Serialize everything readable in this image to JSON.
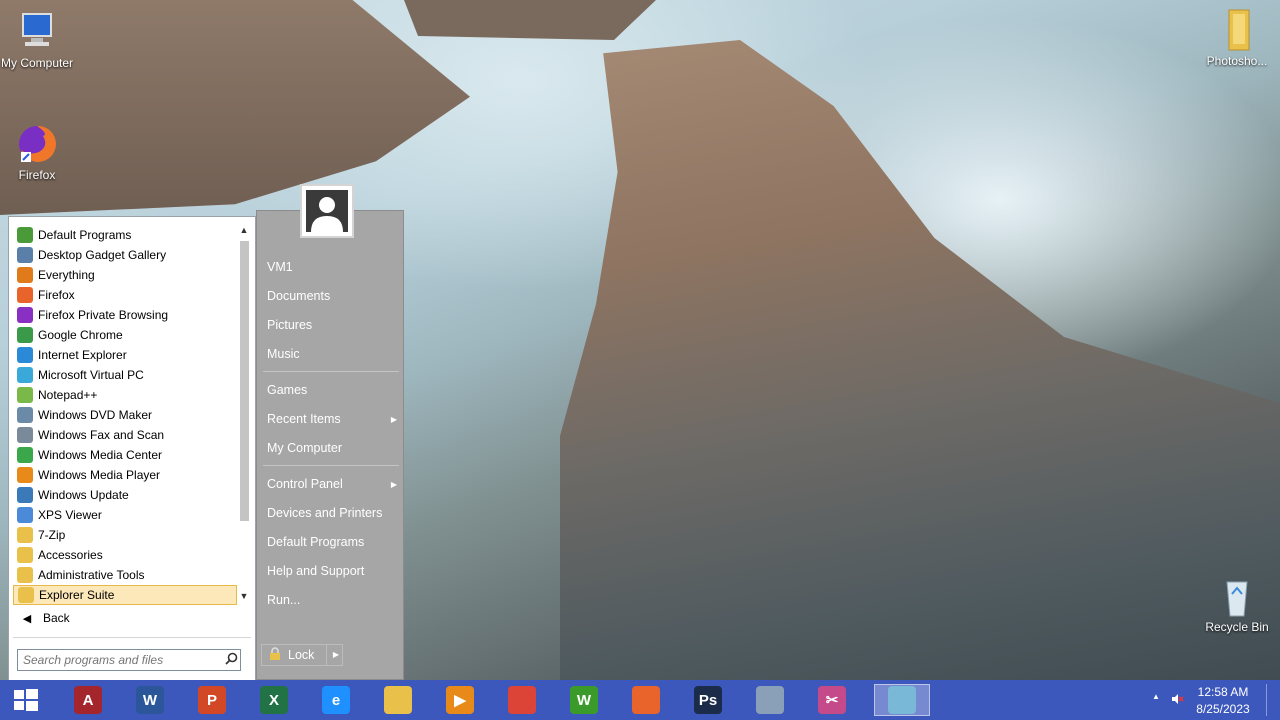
{
  "desktop": {
    "icons": [
      {
        "label": "My Computer"
      },
      {
        "label": "Firefox"
      },
      {
        "label": "Photosho..."
      },
      {
        "label": "Recycle Bin"
      }
    ]
  },
  "start_menu": {
    "programs": [
      {
        "label": "Default Programs",
        "icon": "default-programs-icon",
        "color": "#4a9a3a"
      },
      {
        "label": "Desktop Gadget Gallery",
        "icon": "gadget-gallery-icon",
        "color": "#5a7fa8"
      },
      {
        "label": "Everything",
        "icon": "everything-search-icon",
        "color": "#e07a1a"
      },
      {
        "label": "Firefox",
        "icon": "firefox-icon",
        "color": "#e8642a"
      },
      {
        "label": "Firefox Private Browsing",
        "icon": "firefox-private-icon",
        "color": "#8a2fc4"
      },
      {
        "label": "Google Chrome",
        "icon": "chrome-icon",
        "color": "#3a9a4a"
      },
      {
        "label": "Internet Explorer",
        "icon": "internet-explorer-icon",
        "color": "#2a8ad8"
      },
      {
        "label": "Microsoft Virtual PC",
        "icon": "virtual-pc-icon",
        "color": "#3aa8d8"
      },
      {
        "label": "Notepad++",
        "icon": "notepad-plus-icon",
        "color": "#7ab84a"
      },
      {
        "label": "Windows DVD Maker",
        "icon": "dvd-maker-icon",
        "color": "#6a8aa8"
      },
      {
        "label": "Windows Fax and Scan",
        "icon": "fax-scan-icon",
        "color": "#7a8a9a"
      },
      {
        "label": "Windows Media Center",
        "icon": "media-center-icon",
        "color": "#3aa84a"
      },
      {
        "label": "Windows Media Player",
        "icon": "media-player-icon",
        "color": "#e88a1a"
      },
      {
        "label": "Windows Update",
        "icon": "windows-update-icon",
        "color": "#3a7ab8"
      },
      {
        "label": "XPS Viewer",
        "icon": "xps-viewer-icon",
        "color": "#4a8ad8"
      },
      {
        "label": "7-Zip",
        "icon": "folder-icon",
        "color": "#e8c04a"
      },
      {
        "label": "Accessories",
        "icon": "folder-icon",
        "color": "#e8c04a"
      },
      {
        "label": "Administrative Tools",
        "icon": "folder-icon",
        "color": "#e8c04a"
      },
      {
        "label": "Explorer Suite",
        "icon": "folder-icon",
        "color": "#e8c04a",
        "selected": true
      }
    ],
    "back_label": "Back",
    "search_placeholder": "Search programs and files",
    "right_items": {
      "vm1": "VM1",
      "documents": "Documents",
      "pictures": "Pictures",
      "music": "Music",
      "games": "Games",
      "recent_items": "Recent Items",
      "my_computer": "My Computer",
      "control_panel": "Control Panel",
      "devices_printers": "Devices and Printers",
      "default_programs": "Default Programs",
      "help_support": "Help and Support",
      "run": "Run..."
    },
    "lock_label": "Lock"
  },
  "taskbar": {
    "apps": [
      {
        "name": "access-icon",
        "letter": "A",
        "color": "#a4262c"
      },
      {
        "name": "word-icon",
        "letter": "W",
        "color": "#2b579a"
      },
      {
        "name": "powerpoint-icon",
        "letter": "P",
        "color": "#d24726"
      },
      {
        "name": "excel-icon",
        "letter": "X",
        "color": "#217346"
      },
      {
        "name": "internet-explorer-icon",
        "letter": "e",
        "color": "#1e90ff"
      },
      {
        "name": "file-explorer-icon",
        "letter": "",
        "color": "#e8c04a"
      },
      {
        "name": "media-player-icon",
        "letter": "▶",
        "color": "#e88a1a"
      },
      {
        "name": "chrome-icon",
        "letter": "",
        "color": "#db4437"
      },
      {
        "name": "winamp-games-icon",
        "letter": "W",
        "color": "#3a9a2a"
      },
      {
        "name": "firefox-icon",
        "letter": "",
        "color": "#e8642a"
      },
      {
        "name": "photoshop-icon",
        "letter": "Ps",
        "color": "#1b2c4a"
      },
      {
        "name": "network-computer-icon",
        "letter": "",
        "color": "#8aa0b8"
      },
      {
        "name": "snipping-tool-icon",
        "letter": "✂",
        "color": "#c44a8a"
      },
      {
        "name": "disc-burner-icon",
        "letter": "",
        "color": "#7ab8d8",
        "active": true
      }
    ],
    "clock": {
      "time": "12:58 AM",
      "date": "8/25/2023"
    }
  }
}
